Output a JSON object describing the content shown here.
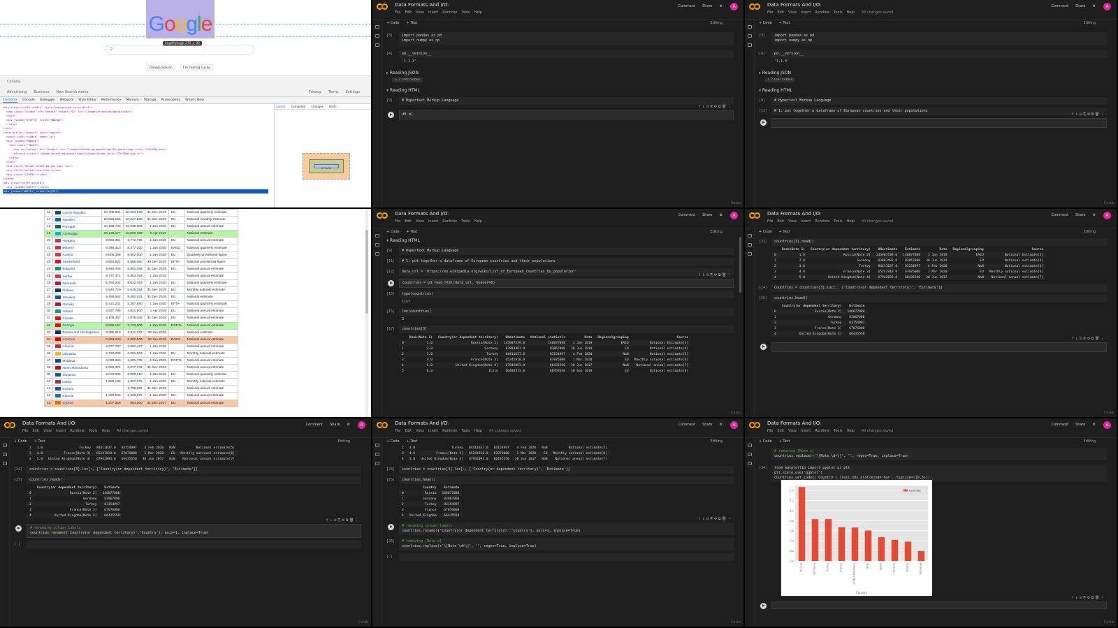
{
  "notebook": {
    "title": "Data Formats And I/O",
    "menu": [
      "File",
      "Edit",
      "View",
      "Insert",
      "Runtime",
      "Tools",
      "Help"
    ],
    "saved": "All changes saved",
    "actions": {
      "comment": "Comment",
      "share": "Share"
    },
    "avatar_letter": "A",
    "code_btn": "+ Code",
    "text_btn": "+ Text",
    "editing": "Editing",
    "ram": "RAM",
    "disk": "Disk",
    "corner": "Colab"
  },
  "cells": {
    "import_code": "import pandas as pd\nimport numpy as np",
    "import_exec": "[3]",
    "version_code": "pd.__version__",
    "version_exec": "[4]",
    "version_out": "'1.1.3'",
    "reading_json": "Reading JSON",
    "hidden": "↳ 7 cells hidden",
    "reading_html": "Reading HTML",
    "hypertext": "# Hypertext Markup Language",
    "hypertext_exec": "[9]",
    "partial_code": "#1 ml",
    "dataframe_comment": "# 1: put together a dataframe of European countries and their populations",
    "dataframe_exec": "[11]",
    "data_url_code": "data_url = 'https://en.wikipedia.org/wiki/List_of_European_countries_by_population'",
    "data_url_exec": "[12]",
    "read_html_code": "countries = pd.read_html(data_url, header=0)",
    "type_code": "type(countries)",
    "type_exec": "[15]",
    "type_out": "list",
    "len_code": "len(countries)",
    "len_exec": "[16]",
    "len_out": "3",
    "idx_code": "countries[3]",
    "idx_exec": "[17]",
    "head_code": "countries[3].head()",
    "head_exec": "[22]",
    "loc_code": "countries = countries[3].loc[:, ['Country(or dependent territory)', 'Estimate']]",
    "loc_exec": "[24]",
    "head2_code": "countries.head()",
    "head2_exec": "[25]",
    "rename_comment": "# renaming column labels",
    "rename_code": "countries.rename({'Country(or dependent territory)':'Country'}, axis=1, inplace=True)",
    "replace_comment": "# removing [Note x]",
    "replace_code": "countries.replace(r'\\[Note \\d+\\]', '', regex=True, inplace=True)",
    "replace_exec": "[26]",
    "plot_code": "from matplotlib import pyplot as plt\nplt.style.use('ggplot')\ncountries.set_index('Country').iloc[:10].plot(kind='bar', figsize=(10,5));",
    "plot_exec": "[34]",
    "empty_exec": "[ ]"
  },
  "df_full": {
    "headers": [
      "",
      "Rank(Note 1)",
      "Country(or dependent territory)",
      "UNestimate",
      "National statistic",
      "Date",
      "Regionalgrouping",
      "Source"
    ],
    "rows": [
      [
        "0",
        "1.0",
        "Russia[Note 2]",
        "145907539.0",
        "146877088",
        "1 Jan 2019",
        "EAEU",
        "National Estimate[3]"
      ],
      [
        "1",
        "2.0",
        "Germany",
        "83883481.0",
        "83067000",
        "30 Jun 2019",
        "EU",
        "National estimate[4]"
      ],
      [
        "2",
        "3.0",
        "Turkey",
        "84411637.0",
        "83154997",
        "4 Feb 2020",
        "NaN",
        "National estimate[5]"
      ],
      [
        "3",
        "4.0",
        "France[Note 3]",
        "65241918.0",
        "67076000",
        "1 Mar 2020",
        "EU",
        "Monthly national estimate[6]"
      ],
      [
        "4",
        "5.0",
        "United Kingdom[Note 4]",
        "67942093.0",
        "66435550",
        "30 Jun 2017",
        "NaN",
        "National annual estimate[7]"
      ],
      [
        "5",
        "6.0",
        "Italy",
        "60488373.0",
        "60359546",
        "30 Sep 2019",
        "EU",
        "National estimate[8]"
      ]
    ]
  },
  "df_head": {
    "headers": [
      "",
      "Rank(Note 1)",
      "Country(or dependent territory)",
      "UNestimate",
      "Estimate",
      "Date",
      "Regionalgrouping",
      "Source"
    ],
    "rows": [
      [
        "0",
        "1.0",
        "Russia[Note 2]",
        "145907539.0",
        "146877088",
        "1 Jan 2019",
        "EAEU",
        "National Estimate[3]"
      ],
      [
        "1",
        "2.0",
        "Germany",
        "83883481.0",
        "83067000",
        "30 Jun 2019",
        "EU",
        "National estimate[4]"
      ],
      [
        "2",
        "3.0",
        "Turkey",
        "84411637.0",
        "83154997",
        "4 Feb 2020",
        "NaN",
        "National estimate[5]"
      ],
      [
        "3",
        "4.0",
        "France[Note 3]",
        "65241918.0",
        "67076000",
        "1 Mar 2020",
        "EU",
        "Monthly national estimate[6]"
      ],
      [
        "4",
        "5.0",
        "United Kingdom[Note 4]",
        "67942093.0",
        "66435550",
        "30 Jun 2017",
        "NaN",
        "National annual estimate[7]"
      ]
    ]
  },
  "df_small": {
    "headers": [
      "",
      "Country(or dependent territory)",
      "Estimate"
    ],
    "rows": [
      [
        "0",
        "Russia[Note 2]",
        "146877088"
      ],
      [
        "1",
        "Germany",
        "83067000"
      ],
      [
        "2",
        "Turkey",
        "83154997"
      ],
      [
        "3",
        "France[Note 3]",
        "67076000"
      ],
      [
        "4",
        "United Kingdom[Note 4]",
        "66435550"
      ]
    ]
  },
  "df_renamed": {
    "headers": [
      "",
      "Country",
      "Estimate"
    ],
    "rows": [
      [
        "0",
        "Russia",
        "146877088"
      ],
      [
        "1",
        "Germany",
        "83067000"
      ],
      [
        "2",
        "Turkey",
        "83154997"
      ],
      [
        "3",
        "France",
        "67076000"
      ],
      [
        "4",
        "United Kingdom",
        "66435550"
      ]
    ]
  },
  "google": {
    "tooltip": "img#hplogo 272 × 92",
    "search_placeholder": "",
    "btn_search": "Google Search",
    "btn_lucky": "I'm Feeling Lucky",
    "country": "Canada",
    "footer_left": [
      "Advertising",
      "Business",
      "How Search works"
    ],
    "footer_right": [
      "Privacy",
      "Terms",
      "Settings"
    ],
    "devtools_tabs": [
      "Elements",
      "Console",
      "Debugger",
      "Network",
      "Style Editor",
      "Performance",
      "Memory",
      "Storage",
      "Accessibility",
      "What's New"
    ],
    "styles_tabs": [
      "Layout",
      "Computed",
      "Changes",
      "Fonts"
    ],
    "box_label": "272×92",
    "element_lines": [
      "<div class=\"k1zIA rSk4se\" style=\"background-color:#fff\">",
      "  <img class=\"lnXdpd\" alt=\"Google\" height=\"92\" src=\"/images/branding/googlelogo\">",
      "  </div>",
      "  <div jsname=\"bYaFYe\" class=\"RNNXgb\">",
      "  ::after",
      "</div>",
      "<form action=\"/search\" role=\"search\">",
      "  <input type=\"hidden\" name=\"ie\">",
      "  <div jsname=\"RNNXgb\">",
      "    <div class=\"SDkEP\">",
      "      <img id=\"hplogo\" alt=\"Google\" src=\"/images/branding/googlelogo/2x/googlelogo_color_272x92dp.png\">",
      "      <picture srcset=\"/images/branding/googlelogo/1x/googlelogo_color_272x92dp.png 1x\">",
      "    </div>",
      "  </div>",
      "  <div style=\"height:233px;margin-top:-1px\">",
      "  <div style=\"margin-top:12px\"></div>",
      "  <div class=\"lJ9FBc\"></div>",
      "</form>",
      "<div class=\"o3j99 qarstb\">",
      "  <div jsname=\"bN97Pc\"></div>"
    ],
    "selected_line": "<div jsname=\"bN97Pc\" class=\"o3j99\">"
  },
  "wiki_rows": [
    {
      "rank": "16",
      "name": "Czech Republic",
      "un": "10,708,981",
      "stat": "10,693,939",
      "date": "31 Dec 2019",
      "grp": "EU",
      "src": "National quarterly estimate",
      "flag": "#11457e",
      "hl": ""
    },
    {
      "rank": "17",
      "name": "Sweden",
      "un": "10,099,265",
      "stat": "10,327,589",
      "date": "31 Dec 2019",
      "grp": "EU",
      "src": "National monthly estimate",
      "flag": "#006aa7",
      "hl": ""
    },
    {
      "rank": "18",
      "name": "Portugal",
      "un": "10,196,709",
      "stat": "10,295,909",
      "date": "1 Jan 2019",
      "grp": "EU",
      "src": "National annual estimate",
      "flag": "#046a38",
      "hl": ""
    },
    {
      "rank": "19",
      "name": "Azerbaijan",
      "un": "10,139,177",
      "stat": "10,000,000",
      "date": "6 Apr 2019",
      "grp": "",
      "src": "National estimate",
      "flag": "#00b5e2",
      "hl": "green"
    },
    {
      "rank": "20",
      "name": "Hungary",
      "un": "9,660,351",
      "stat": "9,772,756",
      "date": "1 Jan 2019",
      "grp": "EU",
      "src": "National annual estimate",
      "flag": "#cd2a3e",
      "hl": ""
    },
    {
      "rank": "21",
      "name": "Belarus",
      "un": "9,449,323",
      "stat": "9,477,100",
      "date": "1 Jan 2020",
      "grp": "EAEU",
      "src": "National quarterly estimate",
      "flag": "#c8313e",
      "hl": ""
    },
    {
      "rank": "22",
      "name": "Austria",
      "un": "9,006,398",
      "stat": "8,902,600",
      "date": "1 Jan 2020",
      "grp": "EU",
      "src": "Quarterly provisional figure",
      "flag": "#ed2939",
      "hl": ""
    },
    {
      "rank": "23",
      "name": "Switzerland",
      "un": "8,654,622",
      "stat": "8,586,550",
      "date": "30 Dec 2019",
      "grp": "EFTA",
      "src": "National provisional figure",
      "flag": "#ff0000",
      "hl": ""
    },
    {
      "rank": "24",
      "name": "Bulgaria",
      "un": "6,948,445",
      "stat": "6,951,482",
      "date": "31 Dec 2019",
      "grp": "EU",
      "src": "National annual estimate",
      "flag": "#00966e",
      "hl": ""
    },
    {
      "rank": "25",
      "name": "Serbia",
      "un": "8,737,371",
      "stat": "6,963,764",
      "date": "1 Jan 2019",
      "grp": "",
      "src": "National annual estimate",
      "flag": "#c6363c",
      "hl": ""
    },
    {
      "rank": "26",
      "name": "Denmark",
      "un": "5,792,202",
      "stat": "5,822,763",
      "date": "1 Jan 2020",
      "grp": "EU",
      "src": "National quarterly estimate",
      "flag": "#c8102e",
      "hl": ""
    },
    {
      "rank": "27",
      "name": "Finland",
      "un": "5,540,720",
      "stat": "5,525,292",
      "date": "31 Dec 2019",
      "grp": "EU",
      "src": "Monthly national estimate",
      "flag": "#003580",
      "hl": ""
    },
    {
      "rank": "28",
      "name": "Slovakia",
      "un": "5,459,642",
      "stat": "5,450,421",
      "date": "31 Dec 2018",
      "grp": "EU",
      "src": "National estimate",
      "flag": "#0b4ea2",
      "hl": ""
    },
    {
      "rank": "29",
      "name": "Norway",
      "un": "5,421,241",
      "stat": "5,367,580",
      "date": "1 Jan 2020",
      "grp": "EFTA",
      "src": "National quarterly estimate",
      "flag": "#ba0c2f",
      "hl": ""
    },
    {
      "rank": "30",
      "name": "Ireland",
      "un": "4,937,786",
      "stat": "4,921,500",
      "date": "1 Apr 2019",
      "grp": "EU",
      "src": "National annual estimate",
      "flag": "#169b62",
      "hl": ""
    },
    {
      "rank": "31",
      "name": "Croatia",
      "un": "4,105,267",
      "stat": "4,076,246",
      "date": "31 Dec 2018",
      "grp": "EU",
      "src": "National annual estimate",
      "flag": "#ff0000",
      "hl": ""
    },
    {
      "rank": "32",
      "name": "Georgia",
      "un": "3,989,167",
      "stat": "3,723,500",
      "date": "1 Jan 2019",
      "grp": "DCFTA",
      "src": "National annual estimate",
      "flag": "#ff0000",
      "hl": "green"
    },
    {
      "rank": "33",
      "name": "Bosnia and Herzegovina",
      "un": "3,280,819",
      "stat": "3,511,372",
      "date": "30 Jun 2019",
      "grp": "",
      "src": "National estimate",
      "flag": "#002395",
      "hl": ""
    },
    {
      "rank": "34",
      "name": "Armenia",
      "un": "2,963,243",
      "stat": "2,962,500",
      "date": "30 Jun 2019",
      "grp": "EAEU",
      "src": "National annual estimate",
      "flag": "#d90012",
      "hl": "orange"
    },
    {
      "rank": "35",
      "name": "Albania",
      "un": "2,877,797",
      "stat": "2,862,427",
      "date": "1 Jan 2019",
      "grp": "",
      "src": "National annual estimate",
      "flag": "#e41e20",
      "hl": ""
    },
    {
      "rank": "36",
      "name": "Lithuania",
      "un": "2,722,289",
      "stat": "2,791,903",
      "date": "1 Jan 2020",
      "grp": "EU",
      "src": "Monthly national estimate",
      "flag": "#fdb913",
      "hl": ""
    },
    {
      "rank": "37",
      "name": "Moldova",
      "un": "4,033,963",
      "stat": "2,681,735",
      "date": "1 Jan 2019",
      "grp": "DCFTA",
      "src": "National annual estimate",
      "flag": "#0046ae",
      "hl": ""
    },
    {
      "rank": "38",
      "name": "North Macedonia",
      "un": "2,083,374",
      "stat": "2,077,132",
      "date": "31 Dec 2018",
      "grp": "",
      "src": "National annual estimate",
      "flag": "#d20000",
      "hl": ""
    },
    {
      "rank": "39",
      "name": "Slovenia",
      "un": "2,078,938",
      "stat": "2,089,310",
      "date": "1 Jan 2019",
      "grp": "EU",
      "src": "National quarterly estimate",
      "flag": "#005da4",
      "hl": ""
    },
    {
      "rank": "40",
      "name": "Latvia",
      "un": "1,886,198",
      "stat": "1,907,675",
      "date": "1 Jan 2020",
      "grp": "EU",
      "src": "Monthly national estimate",
      "flag": "#9e3039",
      "hl": ""
    },
    {
      "rank": "41",
      "name": "Kosovo",
      "un": "",
      "stat": "1,795,666",
      "date": "31 Dec 2019",
      "grp": "",
      "src": "National annual estimate",
      "flag": "#244aa5",
      "hl": ""
    },
    {
      "rank": "42",
      "name": "Estonia",
      "un": "1,326,535",
      "stat": "1,328,976",
      "date": "1 Jan 2020",
      "grp": "EU",
      "src": "National annual estimate",
      "flag": "#0072ce",
      "hl": ""
    },
    {
      "rank": "43",
      "name": "Cyprus",
      "un": "1,207,359",
      "stat": "864,200",
      "date": "31 Dec 2017",
      "grp": "EU",
      "src": "National annual estimate",
      "flag": "#d57800",
      "hl": "orange"
    }
  ],
  "chart_data": {
    "type": "bar",
    "categories": [
      "Russia",
      "Germany",
      "Turkey",
      "France",
      "United Kingdom",
      "Italy",
      "Spain",
      "Ukraine",
      "Poland",
      "Romania"
    ],
    "values": [
      146877088,
      83067000,
      83154997,
      67076000,
      66435550,
      60359546,
      47100396,
      41902416,
      38386000,
      19405156
    ],
    "series": [
      {
        "name": "Estimate"
      }
    ],
    "xlabel": "Country",
    "ylim": [
      0,
      150000000
    ],
    "legend": "top-right",
    "color": "#e24a33",
    "grid": true
  }
}
